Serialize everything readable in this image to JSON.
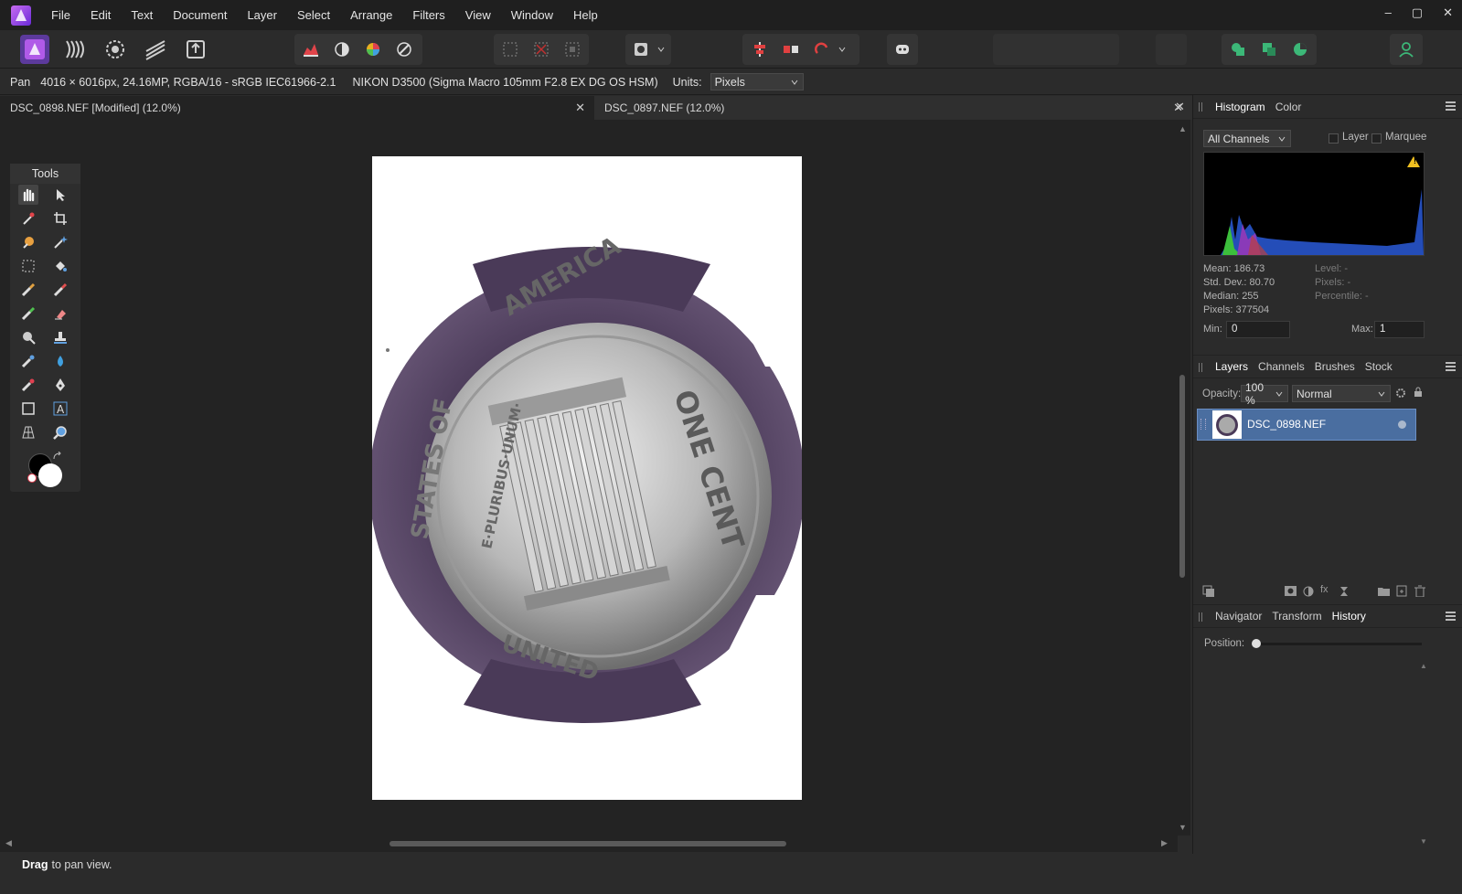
{
  "menubar": {
    "items": [
      "File",
      "Edit",
      "Text",
      "Document",
      "Layer",
      "Select",
      "Arrange",
      "Filters",
      "View",
      "Window",
      "Help"
    ],
    "controls": {
      "minimize": "‒",
      "maximize": "▢",
      "close": "✕"
    }
  },
  "toolbar": {
    "personas": [
      "photo-persona",
      "liquify-persona",
      "develop-persona",
      "tone-mapping-persona",
      "export-persona"
    ]
  },
  "context": {
    "tool": "Pan",
    "image_info": "4016 × 6016px, 24.16MP, RGBA/16 - sRGB IEC61966-2.1",
    "camera_info": "NIKON D3500 (Sigma Macro 105mm F2.8 EX DG OS HSM)",
    "units_label": "Units:",
    "units_value": "Pixels"
  },
  "tabs": [
    {
      "label": "DSC_0898.NEF [Modified] (12.0%)",
      "close": "✕"
    },
    {
      "label": "DSC_0897.NEF (12.0%)",
      "close": "✕"
    }
  ],
  "tools_panel": {
    "title": "Tools"
  },
  "histogram_panel": {
    "tabs": [
      "Histogram",
      "Color"
    ],
    "channel": "All Channels",
    "layer_label": "Layer",
    "marquee_label": "Marquee",
    "warning": "!",
    "stats": {
      "mean": "Mean: 186.73",
      "std_dev": "Std. Dev.: 80.70",
      "median": "Median: 255",
      "pixels": "Pixels: 377504",
      "level": "Level: -",
      "pixels_sel": "Pixels: -",
      "percentile": "Percentile: -"
    },
    "min_label": "Min:",
    "min_value": "0",
    "max_label": "Max:",
    "max_value": "1"
  },
  "layers_panel": {
    "tabs": [
      "Layers",
      "Channels",
      "Brushes",
      "Stock"
    ],
    "opacity_label": "Opacity:",
    "opacity_value": "100 %",
    "blend_mode": "Normal",
    "layers": [
      {
        "name": "DSC_0898.NEF"
      }
    ]
  },
  "history_panel": {
    "tabs": [
      "Navigator",
      "Transform",
      "History"
    ],
    "position_label": "Position:"
  },
  "status": {
    "bold": "Drag",
    "text": "to pan view."
  },
  "coin": {
    "top_text": "STATES OF AMERICA",
    "right_text": "ONE CENT",
    "motto": "E·PLURIBUS · UNUM ·",
    "bottom_text": "UNITED"
  }
}
